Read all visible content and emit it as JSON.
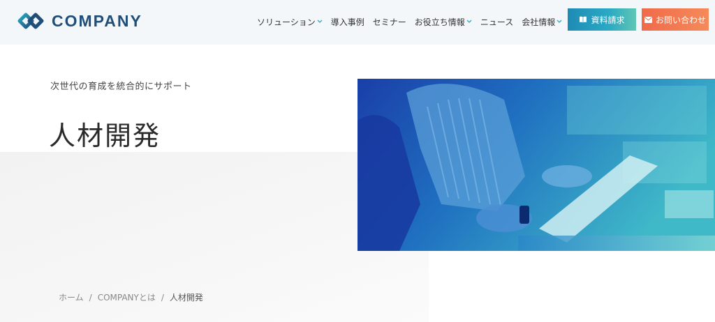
{
  "header": {
    "logo_text": "COMPANY",
    "nav": [
      {
        "label": "ソリューション",
        "dropdown": true
      },
      {
        "label": "導入事例",
        "dropdown": false
      },
      {
        "label": "セミナー",
        "dropdown": false
      },
      {
        "label": "お役立ち情報",
        "dropdown": true
      },
      {
        "label": "ニュース",
        "dropdown": false
      },
      {
        "label": "会社情報",
        "dropdown": true
      }
    ],
    "doc_button": "資料請求",
    "contact_button": "お問い合わせ"
  },
  "hero": {
    "tagline": "次世代の育成を統合的にサポート",
    "title": "人材開発"
  },
  "breadcrumb": {
    "home": "ホーム",
    "parent": "COMPANYとは",
    "current": "人材開発",
    "separator": "/"
  },
  "colors": {
    "brand_dark": "#1f4e79",
    "brand_teal": "#2aa9c4",
    "accent_orange": "#f06a4a"
  }
}
